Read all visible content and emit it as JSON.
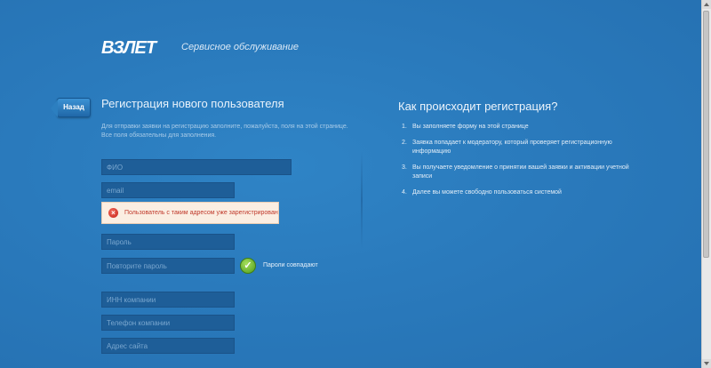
{
  "header": {
    "logo_text": "ВЗЛЕТ",
    "service_title": "Сервисное обслуживание"
  },
  "nav": {
    "back_label": "Назад"
  },
  "form": {
    "title": "Регистрация нового пользователя",
    "description": "Для отправки заявки на регистрацию заполните, пожалуйста, поля на этой странице. Все поля обязательны для заполнения.",
    "fields": {
      "fio": {
        "placeholder": "ФИО",
        "value": ""
      },
      "email": {
        "placeholder": "email",
        "value": ""
      },
      "password": {
        "placeholder": "Пароль",
        "value": ""
      },
      "password_repeat": {
        "placeholder": "Повторите пароль",
        "value": ""
      },
      "inn": {
        "placeholder": "ИНН компании",
        "value": ""
      },
      "phone": {
        "placeholder": "Телефон компании",
        "value": ""
      },
      "website": {
        "placeholder": "Адрес сайта",
        "value": ""
      }
    },
    "email_error": {
      "icon": "error-icon",
      "text": "Пользователь с таким адресом уже зарегистрирован"
    },
    "password_match": {
      "icon": "checkmark-icon",
      "text": "Пароли совпадают"
    }
  },
  "howto": {
    "title": "Как происходит регистрация?",
    "steps": [
      {
        "num": "1.",
        "text": "Вы заполняете форму на этой странице"
      },
      {
        "num": "2.",
        "text": "Заявка попадает к модератору, который проверяет регистрационную информацию"
      },
      {
        "num": "3.",
        "text": "Вы получаете уведомление о принятии вашей заявки и активации учетной записи"
      },
      {
        "num": "4.",
        "text": "Далее вы можете свободно пользоваться системой"
      }
    ]
  },
  "colors": {
    "background": "#2a79bb",
    "field_bg": "#1e5e98",
    "error_bg": "#fbeee2",
    "error_text": "#c0392b",
    "success": "#6cb52d"
  }
}
